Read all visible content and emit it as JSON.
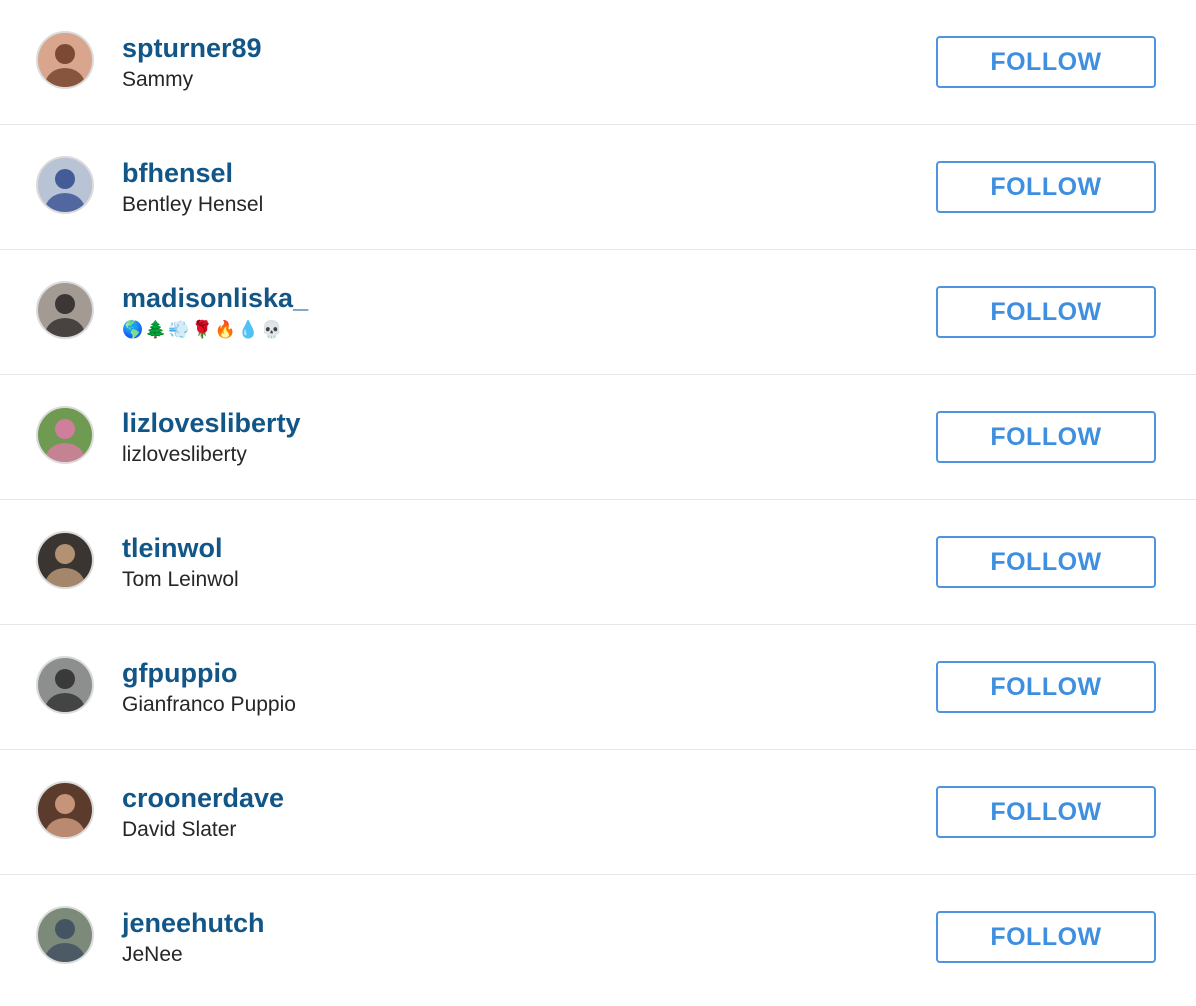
{
  "users": [
    {
      "username": "spturner89",
      "fullname": "Sammy",
      "follow_label": "FOLLOW",
      "avatar_bg": "#d9a58c",
      "avatar_fg": "#6b3a24"
    },
    {
      "username": "bfhensel",
      "fullname": "Bentley Hensel",
      "follow_label": "FOLLOW",
      "avatar_bg": "#b9c3d6",
      "avatar_fg": "#2e4a8c"
    },
    {
      "username": "madisonliska_",
      "fullname": "🌎🌲💨🌹🔥💧💀",
      "follow_label": "FOLLOW",
      "avatar_bg": "#a39a94",
      "avatar_fg": "#2a2624"
    },
    {
      "username": "lizlovesliberty",
      "fullname": "lizlovesliberty",
      "follow_label": "FOLLOW",
      "avatar_bg": "#6f9a52",
      "avatar_fg": "#e07aa8"
    },
    {
      "username": "tleinwol",
      "fullname": "Tom Leinwol",
      "follow_label": "FOLLOW",
      "avatar_bg": "#3a3530",
      "avatar_fg": "#c8a27e"
    },
    {
      "username": "gfpuppio",
      "fullname": "Gianfranco Puppio",
      "follow_label": "FOLLOW",
      "avatar_bg": "#8d8f8e",
      "avatar_fg": "#2b2b2b"
    },
    {
      "username": "croonerdave",
      "fullname": "David Slater",
      "follow_label": "FOLLOW",
      "avatar_bg": "#5a3b2c",
      "avatar_fg": "#d9a487"
    },
    {
      "username": "jeneehutch",
      "fullname": "JeNee",
      "follow_label": "FOLLOW",
      "avatar_bg": "#7c8a7a",
      "avatar_fg": "#3b4a5e"
    }
  ],
  "colors": {
    "username": "#125688",
    "fullname": "#262626",
    "follow_border": "#4d95e0",
    "follow_text": "#3f8fe0",
    "divider": "#e6e6e6"
  },
  "icons": {
    "avatar": "user-avatar-photo"
  }
}
